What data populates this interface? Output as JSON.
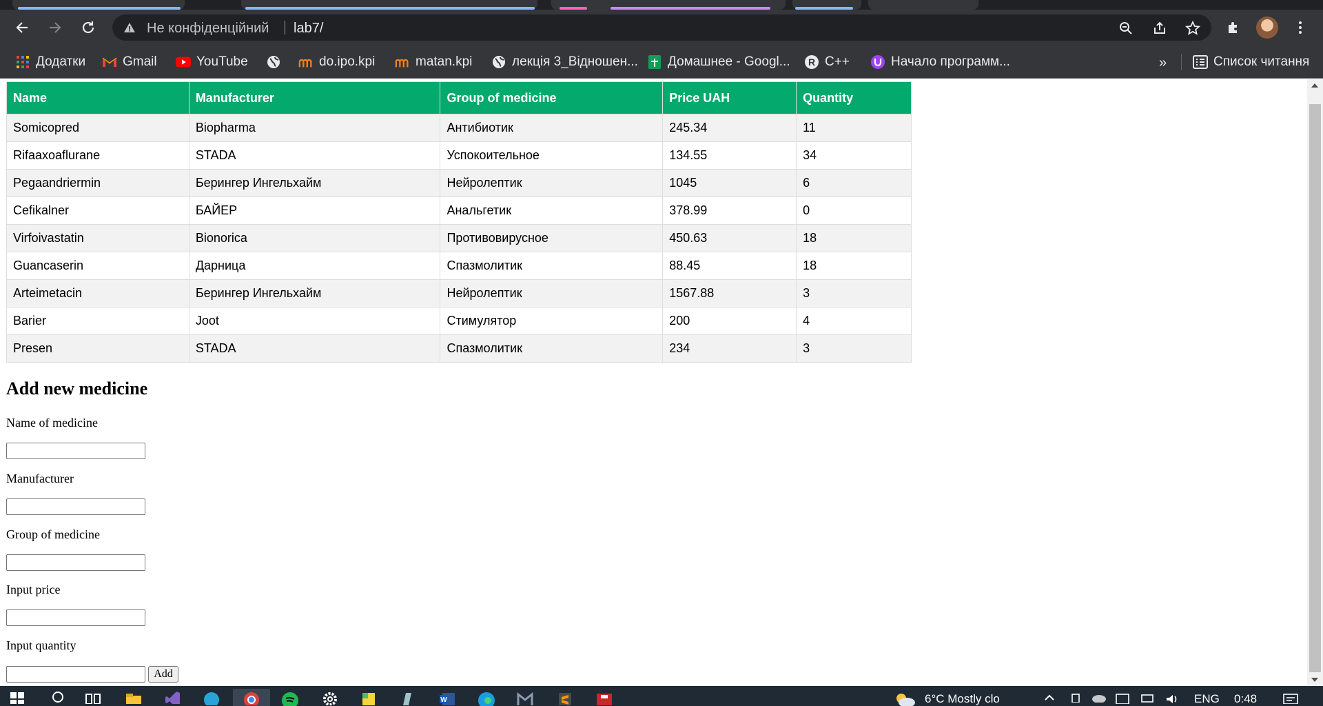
{
  "browser": {
    "omnibox_status": "Не конфіденційний",
    "url": "lab7/"
  },
  "bookmarks": {
    "items": [
      {
        "label": "Додатки",
        "icon": "apps-grid-icon"
      },
      {
        "label": "Gmail",
        "icon": "gmail-icon"
      },
      {
        "label": "YouTube",
        "icon": "youtube-icon"
      },
      {
        "label": "",
        "icon": "globe-icon"
      },
      {
        "label": "do.ipo.kpi",
        "icon": "moodle-icon"
      },
      {
        "label": "matan.kpi",
        "icon": "moodle-icon"
      },
      {
        "label": "лекція 3_Відношен...",
        "icon": "globe-icon"
      },
      {
        "label": "Домашнее - Googl...",
        "icon": "google-sheets-icon"
      },
      {
        "label": "C++",
        "icon": "ranobe-icon"
      },
      {
        "label": "Начало программ...",
        "icon": "purple-u-icon"
      }
    ],
    "overflow": "»",
    "reading_list": "Список читання"
  },
  "table": {
    "headers": [
      "Name",
      "Manufacturer",
      "Group of medicine",
      "Price UAH",
      "Quantity"
    ],
    "rows": [
      [
        "Somicopred",
        "Biopharma",
        "Антибиотик",
        "245.34",
        "11"
      ],
      [
        "Rifaaxoaflurane",
        "STADA",
        "Успокоительное",
        "134.55",
        "34"
      ],
      [
        "Pegaandriermin",
        "Берингер Ингельхайм",
        "Нейролептик",
        "1045",
        "6"
      ],
      [
        "Cefikalner",
        "БАЙЕР",
        "Анальгетик",
        "378.99",
        "0"
      ],
      [
        "Virfoivastatin",
        "Bionorica",
        "Противовирусное",
        "450.63",
        "18"
      ],
      [
        "Guancaserin",
        "Дарница",
        "Спазмолитик",
        "88.45",
        "18"
      ],
      [
        "Arteimetacin",
        "Берингер Ингельхайм",
        "Нейролептик",
        "1567.88",
        "3"
      ],
      [
        "Barier",
        "Joot",
        "Стимулятор",
        "200",
        "4"
      ],
      [
        "Presen",
        "STADA",
        "Спазмолитик",
        "234",
        "3"
      ]
    ],
    "header_color": "#04aa6d"
  },
  "form": {
    "title": "Add new medicine",
    "fields": [
      {
        "label": "Name of medicine",
        "value": ""
      },
      {
        "label": "Manufacturer",
        "value": ""
      },
      {
        "label": "Group of medicine",
        "value": ""
      },
      {
        "label": "Input price",
        "value": ""
      },
      {
        "label": "Input quantity",
        "value": ""
      }
    ],
    "submit_label": "Add"
  },
  "taskbar": {
    "weather": "6°C  Mostly clo",
    "language": "ENG",
    "time": "0:48"
  }
}
